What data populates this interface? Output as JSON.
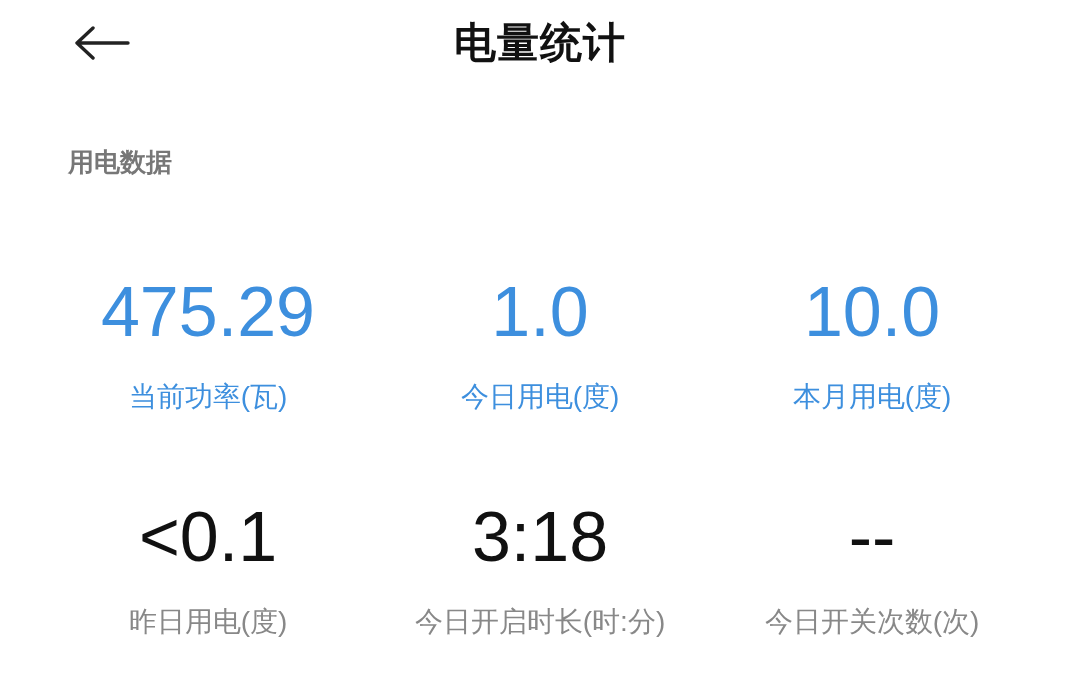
{
  "header": {
    "title": "电量统计"
  },
  "section": {
    "title": "用电数据"
  },
  "stats": [
    {
      "value": "475.29",
      "label": "当前功率(瓦)",
      "highlighted": true
    },
    {
      "value": "1.0",
      "label": "今日用电(度)",
      "highlighted": true
    },
    {
      "value": "10.0",
      "label": "本月用电(度)",
      "highlighted": true
    },
    {
      "value": "<0.1",
      "label": "昨日用电(度)",
      "highlighted": false
    },
    {
      "value": "3:18",
      "label": "今日开启时长(时:分)",
      "highlighted": false
    },
    {
      "value": "--",
      "label": "今日开关次数(次)",
      "highlighted": false
    }
  ]
}
